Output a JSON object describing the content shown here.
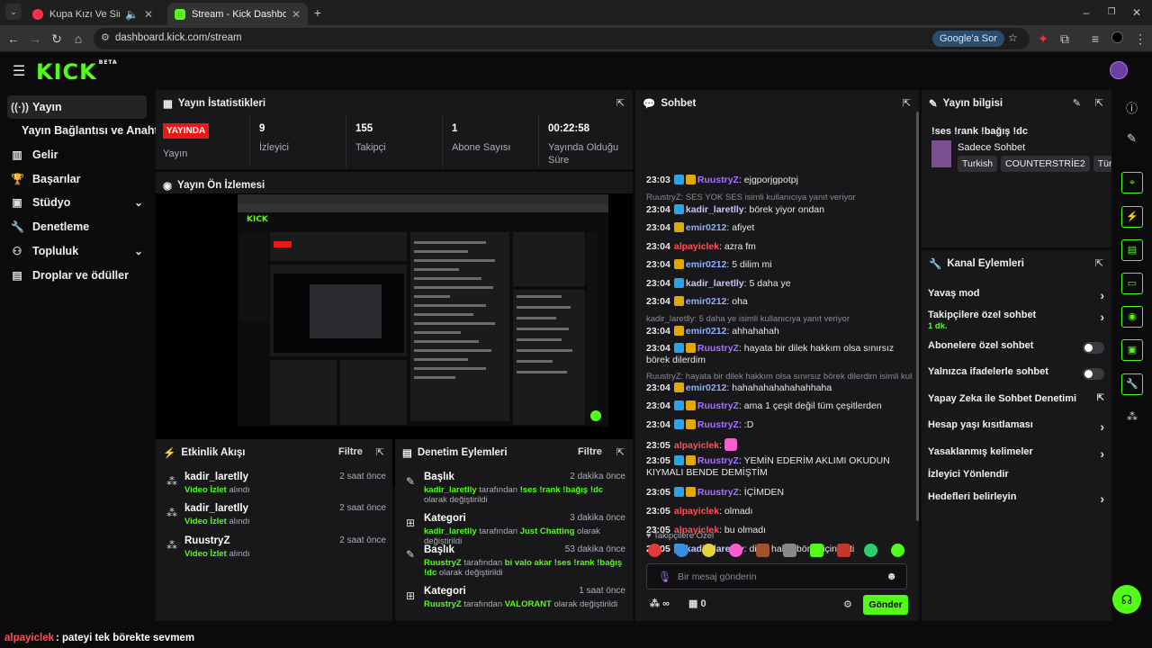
{
  "browser": {
    "tabs": [
      {
        "label": "Kupa Kızı Ve Sinek Valesi | Y"
      },
      {
        "label": "Stream - Kick Dashboard"
      }
    ],
    "url": "dashboard.kick.com/stream",
    "google_sor": "Google'a Sor"
  },
  "app": {
    "logo": "KICK",
    "logo_beta": "BETA"
  },
  "sidebar": {
    "items": [
      {
        "label": "Yayın",
        "icon": "broadcast-icon"
      },
      {
        "label": "Yayın Bağlantısı ve Anahtarı",
        "icon": ""
      },
      {
        "label": "Gelir",
        "icon": "chart-icon"
      },
      {
        "label": "Başarılar",
        "icon": "trophy-icon"
      },
      {
        "label": "Stüdyo",
        "icon": "studio-icon"
      },
      {
        "label": "Denetleme",
        "icon": "wrench-icon"
      },
      {
        "label": "Topluluk",
        "icon": "community-icon"
      },
      {
        "label": "Droplar ve ödüller",
        "icon": "drops-icon"
      }
    ]
  },
  "stats": {
    "title": "Yayın İstatistikleri",
    "live_badge": "YAYINDA",
    "items": [
      {
        "value": "",
        "label": "Yayın"
      },
      {
        "value": "9",
        "label": "İzleyici"
      },
      {
        "value": "155",
        "label": "Takipçi"
      },
      {
        "value": "1",
        "label": "Abone Sayısı"
      },
      {
        "value": "00:22:58",
        "label": "Yayında Olduğu Süre"
      }
    ]
  },
  "preview": {
    "title": "Yayın Ön İzlemesi"
  },
  "activity": {
    "title": "Etkinlik Akışı",
    "filter": "Filtre",
    "items": [
      {
        "name": "kadir_laretlly",
        "time": "2 saat önce",
        "action": "Video İzlet",
        "suffix": "alındı"
      },
      {
        "name": "kadir_laretlly",
        "time": "2 saat önce",
        "action": "Video İzlet",
        "suffix": "alındı"
      },
      {
        "name": "RuustryZ",
        "time": "2 saat önce",
        "action": "Video İzlet",
        "suffix": "alındı"
      }
    ]
  },
  "moderation": {
    "title": "Denetim Eylemleri",
    "filter": "Filtre",
    "items": [
      {
        "type": "Başlık",
        "time": "2 dakika önce",
        "user": "kadir_laretlly",
        "mid": "tarafından",
        "value": "!ses !rank !bağış !dc",
        "end": "olarak değiştirildi"
      },
      {
        "type": "Kategori",
        "time": "3 dakika önce",
        "user": "kadir_laretlly",
        "mid": "tarafından",
        "value": "Just Chatting",
        "end": "olarak değiştirildi"
      },
      {
        "type": "Başlık",
        "time": "53 dakika önce",
        "user": "RuustryZ",
        "mid": "tarafından",
        "value": "bi valo akar !ses !rank !bağış !dc",
        "end": "olarak değiştirildi"
      },
      {
        "type": "Kategori",
        "time": "1 saat önce",
        "user": "RuustryZ",
        "mid": "tarafından",
        "value": "VALORANT",
        "end": "olarak değiştirildi"
      }
    ]
  },
  "chat": {
    "title": "Sohbet",
    "messages": [
      {
        "time": "23:03",
        "user": "RuustryZ",
        "color": "#a970ff",
        "text": "ejgporjgpotpj"
      },
      {
        "reply": "RuustryZ: SES YOK SES isimli kullanıcıya yanıt veriyor"
      },
      {
        "time": "23:04",
        "user": "kadir_laretlly",
        "color": "#c6c6ff",
        "text": "börek yiyor ondan"
      },
      {
        "time": "23:04",
        "user": "emir0212",
        "color": "#8fb0ff",
        "text": "afiyet"
      },
      {
        "time": "23:04",
        "user": "alpayiclek",
        "color": "#ff4f5a",
        "text": "azra fm"
      },
      {
        "time": "23:04",
        "user": "emir0212",
        "color": "#8fb0ff",
        "text": "5 dilim mi"
      },
      {
        "time": "23:04",
        "user": "kadir_laretlly",
        "color": "#c6c6ff",
        "text": "5 daha ye"
      },
      {
        "time": "23:04",
        "user": "emir0212",
        "color": "#8fb0ff",
        "text": "oha"
      },
      {
        "reply": "kadir_laretlly: 5 daha ye isimli kullanıcıya yanıt veriyor"
      },
      {
        "time": "23:04",
        "user": "emir0212",
        "color": "#8fb0ff",
        "text": "ahhahahah"
      },
      {
        "time": "23:04",
        "user": "RuustryZ",
        "color": "#a970ff",
        "text": "hayata bir dilek hakkım olsa sınırsız börek dilerdim"
      },
      {
        "reply": "RuustryZ: hayata bir dilek hakkım olsa sınırsız börek dilerdim isimli kull..."
      },
      {
        "time": "23:04",
        "user": "emir0212",
        "color": "#8fb0ff",
        "text": "hahahahahahahahhaha"
      },
      {
        "time": "23:04",
        "user": "RuustryZ",
        "color": "#a970ff",
        "text": "ama 1 çeşit değil tüm çeşitlerden"
      },
      {
        "time": "23:04",
        "user": "RuustryZ",
        "color": "#a970ff",
        "text": ":D"
      },
      {
        "time": "23:05",
        "user": "alpayiclek",
        "color": "#ff4f5a",
        "text": ""
      },
      {
        "time": "23:05",
        "user": "RuustryZ",
        "color": "#a970ff",
        "text": "YEMİN EDERİM AKLIMI OKUDUN KIYMALI BENDE DEMİŞTİM"
      },
      {
        "time": "23:05",
        "user": "RuustryZ",
        "color": "#a970ff",
        "text": "İÇİMDEN"
      },
      {
        "time": "23:05",
        "user": "alpayiclek",
        "color": "#ff4f5a",
        "text": "olmadı"
      },
      {
        "time": "23:05",
        "user": "alpayiclek",
        "color": "#ff4f5a",
        "text": "bu olmadı"
      },
      {
        "time": "23:05",
        "user": "kadir_laretlly",
        "color": "#c6c6ff",
        "text": "dilek hakkı börek için gitti"
      },
      {
        "time": "23:05",
        "user": "alpayiclek",
        "color": "#ff4f5a",
        "text": "pateyi tek börekte sevmem"
      }
    ],
    "followers_only": "Takipçilere Özel",
    "input_placeholder": "Bir mesaj gönderin",
    "points": "∞",
    "gift_count": "0",
    "send_label": "Gönder"
  },
  "stream_info": {
    "title": "Yayın bilgisi",
    "stream_title": "!ses !rank !bağış !dc",
    "category": "Sadece Sohbet",
    "tags": [
      "Turkish",
      "COUNTERSTRİE2",
      "Tür"
    ]
  },
  "channel_actions": {
    "title": "Kanal Eylemleri",
    "items": [
      {
        "label": "Yavaş mod",
        "control": "chevron"
      },
      {
        "label": "Takipçilere özel sohbet",
        "sub": "1 dk.",
        "control": "chevron"
      },
      {
        "label": "Abonelere özel sohbet",
        "control": "toggle"
      },
      {
        "label": "Yalnızca ifadelerle sohbet",
        "control": "toggle"
      },
      {
        "label": "Yapay Zeka ile Sohbet Denetimi",
        "control": "external"
      },
      {
        "label": "Hesap yaşı kısıtlaması",
        "control": "chevron"
      },
      {
        "label": "Yasaklanmış kelimeler",
        "control": "chevron"
      },
      {
        "label": "İzleyici Yönlendir",
        "control": "none"
      },
      {
        "label": "Hedefleri belirleyin",
        "control": "chevron"
      }
    ]
  },
  "overlay": {
    "user": "alpayiclek",
    "text": ": pateyi tek börekte sevmem"
  },
  "colors": {
    "accent": "#53fc18",
    "live": "#e91916",
    "panel": "#18181b"
  }
}
